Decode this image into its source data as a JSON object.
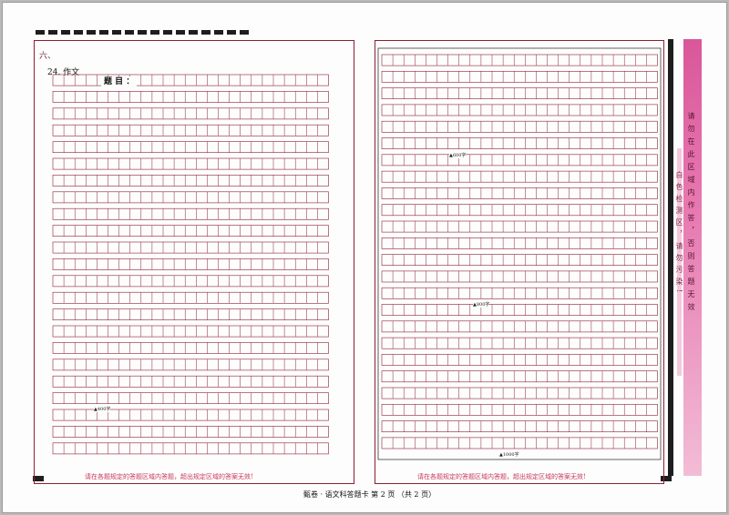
{
  "answer_sheet": {
    "section_label": "六、",
    "question_label": "24. 作文",
    "title_label": "题 目 ：",
    "left_marker": "▲400字",
    "right_marker_600": "▲600字",
    "right_marker_800": "▲800字",
    "right_marker_1000": "▲1000字",
    "footer_note_left": "请在各题规定的答题区域内答题，超出规定区域的答案无效!",
    "footer_note_right": "请在各题规定的答题区域内答题，超出规定区域的答案无效!",
    "page_footer": "甄卷 · 语文科答题卡    第 2 页  （共 2 页）",
    "side_warning": "请勿在此区域内作答，否则答题无效",
    "side_notice": "白色检测区，请勿污染!"
  },
  "colors": {
    "grid_line": "#8c1f33",
    "footer_text": "#c9375d",
    "side_band": "#d9579a"
  }
}
